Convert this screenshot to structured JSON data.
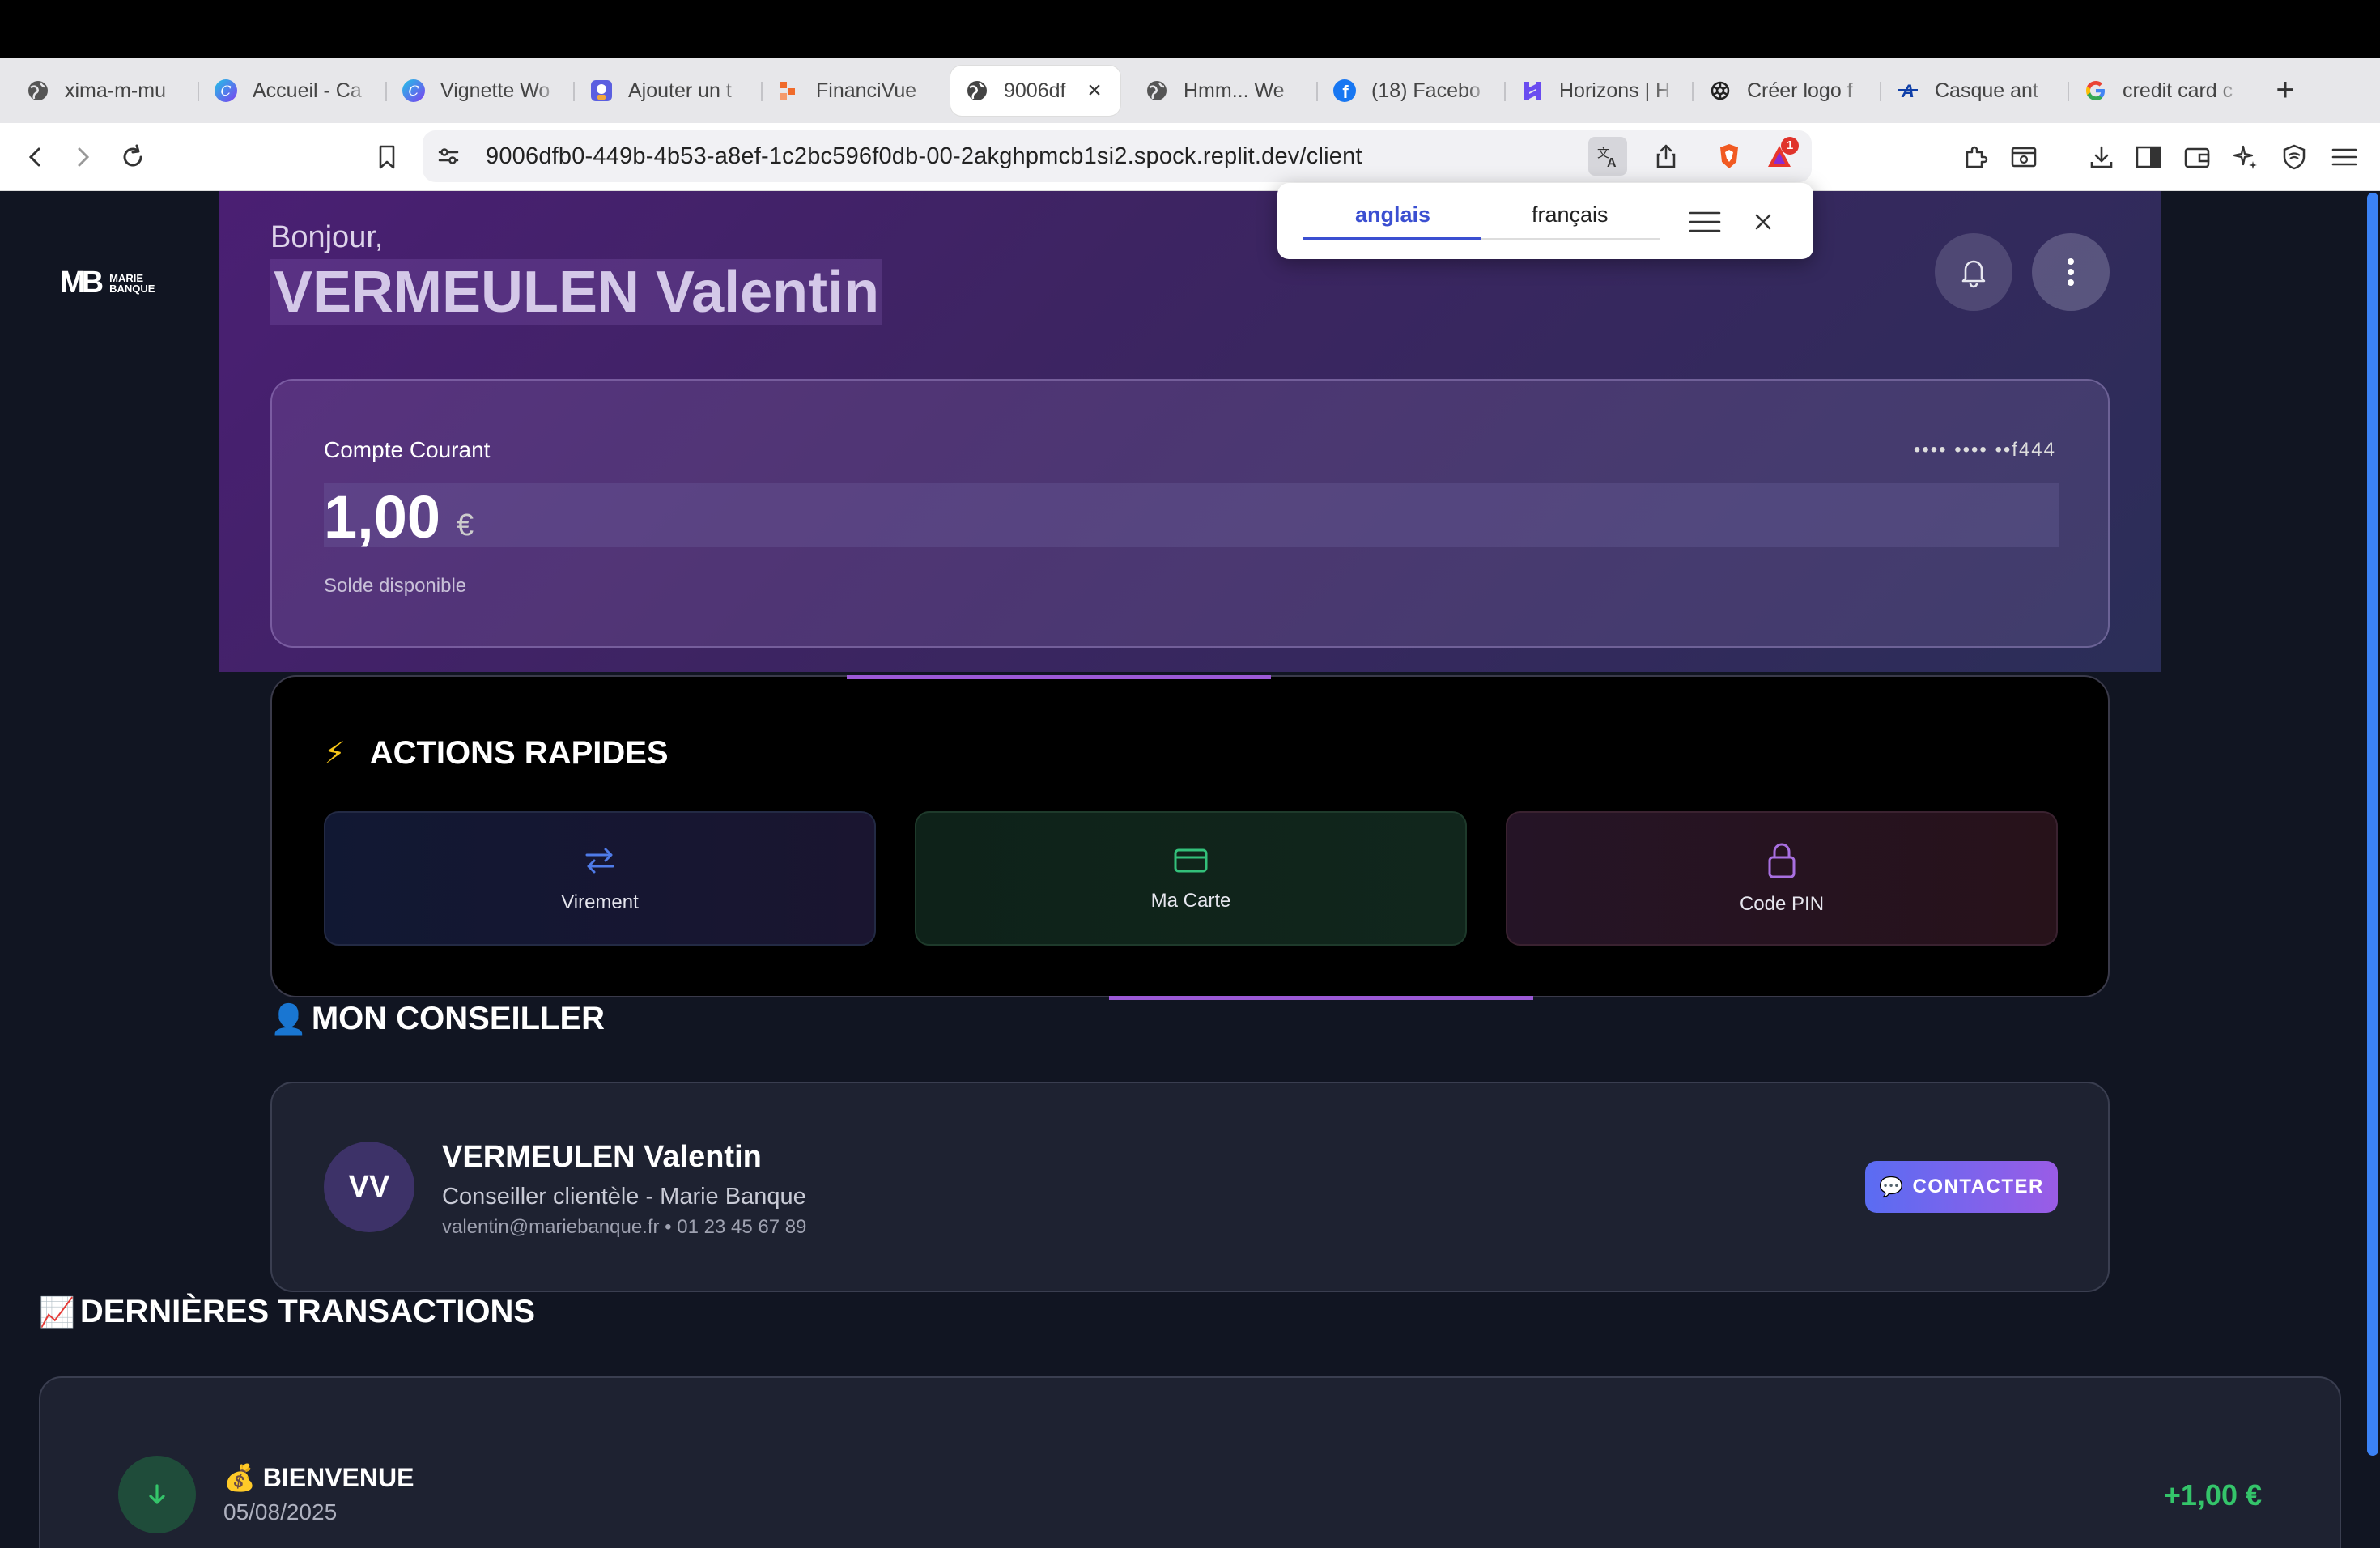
{
  "browser": {
    "tabs": [
      {
        "label": "ximа-m-mu",
        "icon": "globe-icon"
      },
      {
        "label": "Accueil - Ca",
        "icon": "canva-icon"
      },
      {
        "label": "Vignette Wo",
        "icon": "canva-icon"
      },
      {
        "label": "Ajouter un t",
        "icon": "app-icon"
      },
      {
        "label": "FinanciVue",
        "icon": "financivue-icon"
      },
      {
        "label": "9006df",
        "icon": "globe-icon",
        "active": true
      },
      {
        "label": "Hmm... We",
        "icon": "globe-icon"
      },
      {
        "label": "(18) Facebo",
        "icon": "facebook-icon"
      },
      {
        "label": "Horizons | H",
        "icon": "horizons-icon"
      },
      {
        "label": "Créer logo f",
        "icon": "openai-icon"
      },
      {
        "label": "Casque ant",
        "icon": "brand-icon"
      },
      {
        "label": "credit card c",
        "icon": "google-icon"
      }
    ],
    "url": "9006dfb0-449b-4b53-a8ef-1c2bc596f0db-00-2akghpmcb1si2.spock.replit.dev/client",
    "notification_badge": "1"
  },
  "translate_popup": {
    "source_lang": "anglais",
    "target_lang": "français"
  },
  "app": {
    "logo_text_line1": "MARIE",
    "logo_text_line2": "BANQUE",
    "logo_mark": "MB",
    "greeting": "Bonjour,",
    "client_name": "VERMEULEN Valentin",
    "account": {
      "title": "Compte Courant",
      "number_masked": "•••• •••• ••f444",
      "balance": "1,00",
      "currency": "€",
      "balance_label": "Solde disponible"
    },
    "quick_actions": {
      "icon": "⚡",
      "title": "ACTIONS RAPIDES",
      "items": [
        {
          "label": "Virement",
          "icon": "transfer-icon",
          "color": "#4f7be8"
        },
        {
          "label": "Ma Carte",
          "icon": "card-icon",
          "color": "#33c07a"
        },
        {
          "label": "Code PIN",
          "icon": "lock-icon",
          "color": "#a86fe0"
        }
      ]
    },
    "advisor": {
      "icon": "👤",
      "section_title": "MON CONSEILLER",
      "initials": "VV",
      "name": "VERMEULEN Valentin",
      "role": "Conseiller clientèle - Marie Banque",
      "contact": "valentin@mariebanque.fr • 01 23 45 67 89",
      "button_icon": "💬",
      "button_label": "CONTACTER"
    },
    "transactions": {
      "icon": "📈",
      "section_title": "DERNIÈRES TRANSACTIONS",
      "items": [
        {
          "icon": "💰",
          "name": "BIENVENUE",
          "date": "05/08/2025",
          "amount": "+1,00 €",
          "direction": "incoming"
        }
      ]
    }
  },
  "colors": {
    "accent": "#9b59d6",
    "positive": "#34c46a",
    "page_bg": "#111522"
  }
}
